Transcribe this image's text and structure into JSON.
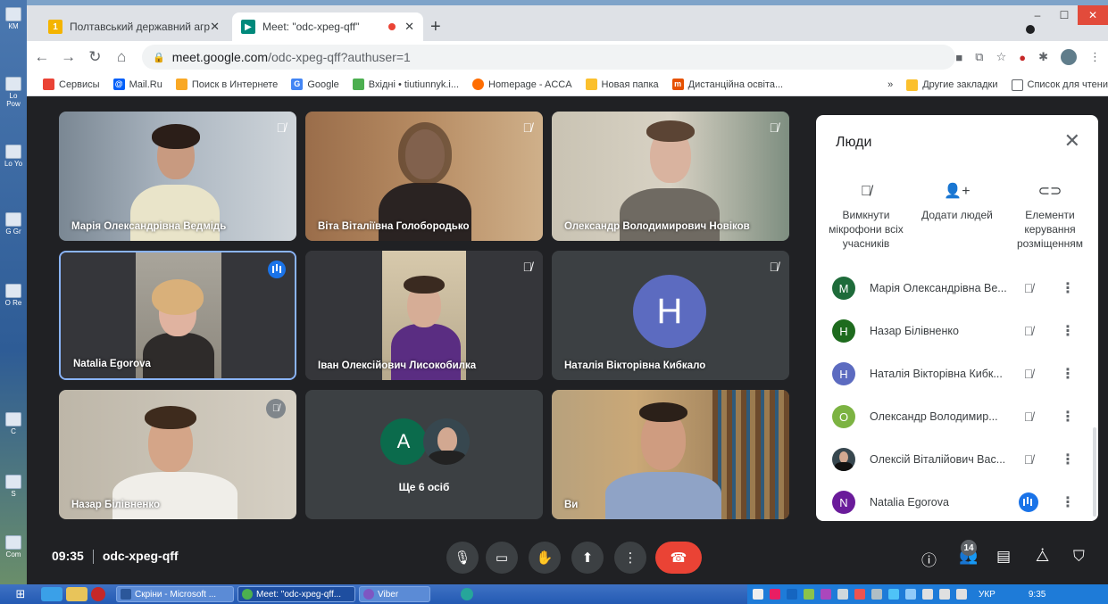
{
  "desktop_icons": [
    {
      "label": "КМ"
    },
    {
      "label": "Lo Pow"
    },
    {
      "label": "Lo Yo"
    },
    {
      "label": "G Gr"
    },
    {
      "label": "O Re"
    },
    {
      "label": "C"
    },
    {
      "label": "S"
    },
    {
      "label": "Com"
    }
  ],
  "tabs": [
    {
      "title": "Полтавський державний аграр",
      "favicon": "ua-flag-icon",
      "color": "#f4b400"
    },
    {
      "title": "Meet: \"odc-xpeg-qff\"",
      "favicon": "meet-icon",
      "color": "#00897b"
    }
  ],
  "tab_close": "✕",
  "new_tab": "+",
  "address": {
    "host": "meet.google.com",
    "path": "/odc-xpeg-qff?authuser=1"
  },
  "bookmarks": [
    {
      "label": "Сервисы",
      "color": "#ea4335",
      "glyph": "⋮"
    },
    {
      "label": "Mail.Ru",
      "color": "#005ff9",
      "glyph": "@"
    },
    {
      "label": "Поиск в Интернете",
      "color": "#f9a825",
      "glyph": "○"
    },
    {
      "label": "Google",
      "color": "#4285f4",
      "glyph": "G"
    },
    {
      "label": "Вхідні • tiutiunnyk.i...",
      "color": "#4caf50",
      "glyph": "✉"
    },
    {
      "label": "Homepage - ACCA",
      "color": "#ff6d00",
      "glyph": "●"
    },
    {
      "label": "Новая папка",
      "color": "#fbc02d",
      "glyph": ""
    },
    {
      "label": "Дистанційна освіта...",
      "color": "#e65100",
      "glyph": "m"
    }
  ],
  "bookmarks_right": {
    "more": "»",
    "other": "Другие закладки",
    "reading": "Список для чтени"
  },
  "tiles": [
    {
      "name": "Марія Олександрівна Ведмідь",
      "state": "muted"
    },
    {
      "name": "Віта Віталіївна Голобородько",
      "state": "muted"
    },
    {
      "name": "Олександр Володимирович Новіков",
      "state": "muted"
    },
    {
      "name": "Natalia Egorova",
      "state": "speaking"
    },
    {
      "name": "Іван Олексійович Лисокобилка",
      "state": "muted"
    },
    {
      "name": "Наталія Вікторівна Кибкало",
      "state": "muted",
      "initial": "Н"
    },
    {
      "name": "Назар Білівненко",
      "state": "muted"
    },
    {
      "name": "Ще 6 осіб",
      "initial": "A"
    },
    {
      "name": "Ви",
      "state": "on"
    }
  ],
  "panel": {
    "title": "Люди",
    "close": "✕",
    "actions": [
      {
        "label": "Вимкнути мікрофони всіх учасників",
        "icon": "mic-off-icon"
      },
      {
        "label": "Додати людей",
        "icon": "add-person-icon"
      },
      {
        "label": "Елементи керування розміщенням",
        "icon": "toggle-icon"
      }
    ],
    "participants": [
      {
        "initial": "M",
        "name": "Марія Олександрівна Ве...",
        "color": "#1e6b3a",
        "mic": "muted"
      },
      {
        "initial": "Н",
        "name": "Назар Білівненко",
        "color": "#1e6b1e",
        "mic": "muted"
      },
      {
        "initial": "Н",
        "name": "Наталія Вікторівна Кибк...",
        "color": "#5c6bc0",
        "mic": "muted"
      },
      {
        "initial": "О",
        "name": "Олександр Володимир...",
        "color": "#7cb342",
        "mic": "muted"
      },
      {
        "initial": "",
        "name": "Олексій Віталійович Вас...",
        "color": "#37474f",
        "mic": "muted"
      },
      {
        "initial": "N",
        "name": "Natalia Egorova",
        "color": "#6a1b9a",
        "mic": "speaking"
      }
    ]
  },
  "bottom": {
    "time": "09:35",
    "code": "odc-xpeg-qff",
    "participants_count": "14"
  },
  "taskbar": {
    "items": [
      {
        "label": "Скріни - Microsoft ...",
        "color": "#2b579a"
      },
      {
        "label": "Meet: \"odc-xpeg-qff...",
        "color": "#4caf50"
      },
      {
        "label": "Viber",
        "color": "#7e57c2"
      }
    ],
    "lang": "УКР",
    "time": "9:35"
  }
}
